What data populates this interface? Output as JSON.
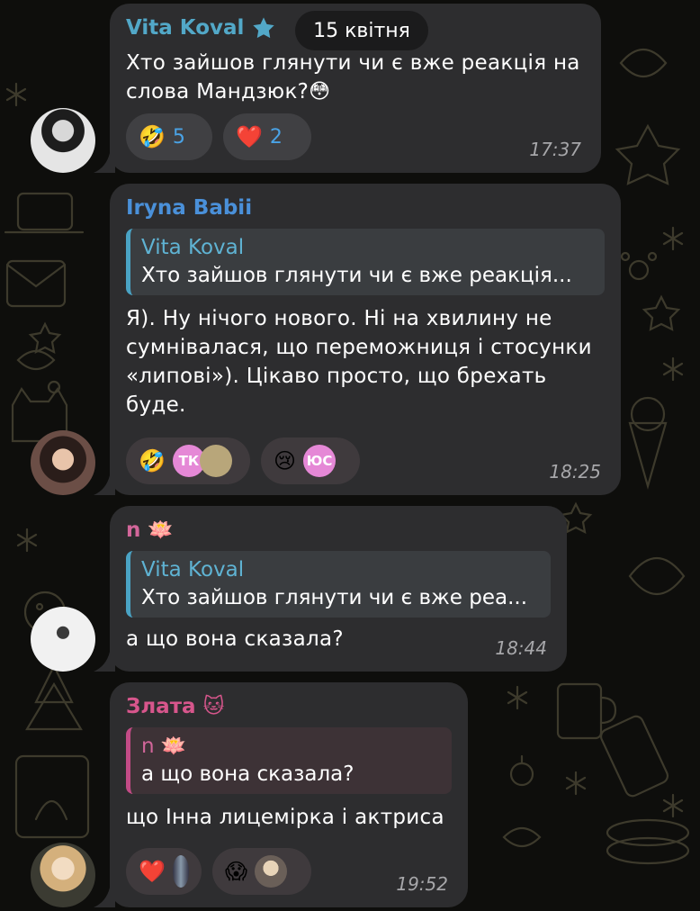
{
  "date_badge": "15 квітня",
  "messages": [
    {
      "sender": "Vita Koval",
      "sender_color": "#52a8c8",
      "text_lines": [
        "Хто зайшов глянути чи є вже реакція на",
        "слова Мандзюк?😳"
      ],
      "reactions": [
        {
          "emoji": "🤣",
          "count": "5"
        },
        {
          "emoji": "❤️",
          "count": "2"
        }
      ],
      "time": "17:37"
    },
    {
      "sender": "Iryna Babii",
      "sender_color": "#4a90d9",
      "reply": {
        "name": "Vita Koval",
        "text": "Хто зайшов глянути чи є вже реакція..."
      },
      "text_lines": [
        "Я). Ну нічого нового. Ні на хвилину не",
        "сумнівалася, що переможниця і стосунки",
        "«липові»). Цікаво просто, що брехать",
        "буде."
      ],
      "reactions": [
        {
          "emoji": "🤣",
          "users": [
            "ТК"
          ]
        },
        {
          "emoji": "😢",
          "users": [
            "ЮС"
          ]
        }
      ],
      "time": "18:25"
    },
    {
      "sender": "n 🪷",
      "sender_color": "#d2669a",
      "reply": {
        "name": "Vita Koval",
        "text": "Хто зайшов глянути чи є вже реа..."
      },
      "text_lines": [
        "а що вона сказала?"
      ],
      "time": "18:44"
    },
    {
      "sender": "Злата 🐱",
      "sender_color": "#d7568c",
      "reply": {
        "name": "n 🪷",
        "text": "а що вона сказала?"
      },
      "text_lines": [
        "що Інна лицемірка і актриса"
      ],
      "reactions": [
        {
          "emoji": "❤️"
        },
        {
          "emoji": "😱"
        }
      ],
      "time": "19:52"
    }
  ]
}
